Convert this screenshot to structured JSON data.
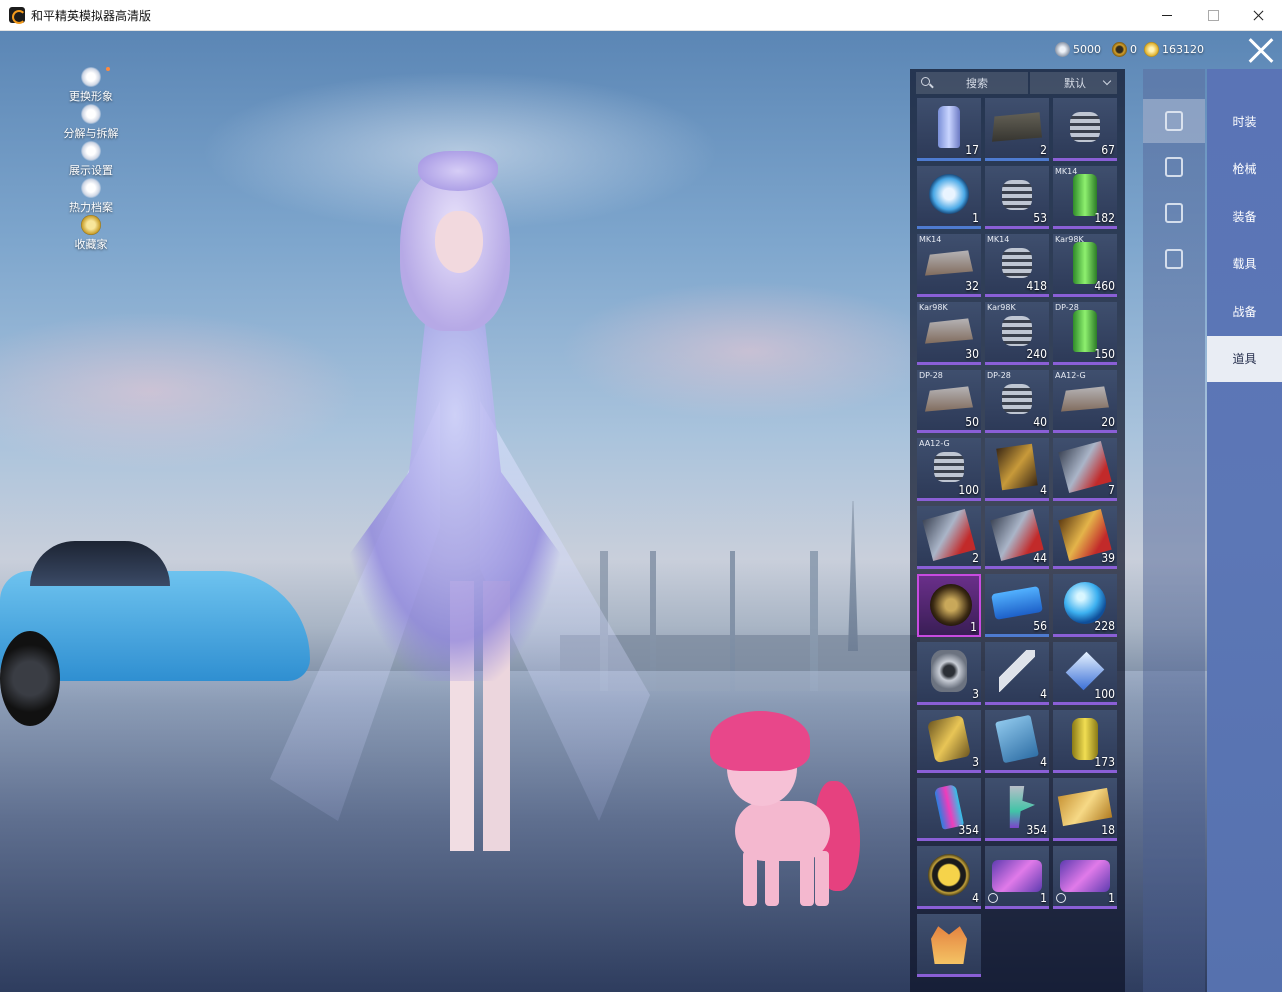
{
  "window": {
    "title": "和平精英模拟器高清版"
  },
  "left_menu": [
    {
      "label": "更换形象",
      "icon": "avatar-icon"
    },
    {
      "label": "分解与拆解",
      "icon": "puzzle-icon"
    },
    {
      "label": "展示设置",
      "icon": "eye-icon"
    },
    {
      "label": "热力档案",
      "icon": "flame-icon"
    },
    {
      "label": "收藏家",
      "icon": "collector-badge-icon"
    }
  ],
  "currency": {
    "silver": "5000",
    "gold_ring": "0",
    "coin": "163120"
  },
  "inventory": {
    "search_label": "搜索",
    "sort_label": "默认",
    "items": [
      {
        "tag": "",
        "count": "17",
        "art": "can",
        "rarity": "r-blue"
      },
      {
        "tag": "",
        "count": "2",
        "art": "kit",
        "rarity": "r-blue"
      },
      {
        "tag": "",
        "count": "67",
        "art": "spring",
        "rarity": "r-purple"
      },
      {
        "tag": "",
        "count": "1",
        "art": "disc",
        "rarity": "r-blue"
      },
      {
        "tag": "",
        "count": "53",
        "art": "spring",
        "rarity": "r-purple"
      },
      {
        "tag": "MK14",
        "count": "182",
        "art": "green",
        "rarity": "r-purple"
      },
      {
        "tag": "MK14",
        "count": "32",
        "art": "mag",
        "rarity": "r-purple"
      },
      {
        "tag": "MK14",
        "count": "418",
        "art": "spring",
        "rarity": "r-purple"
      },
      {
        "tag": "Kar98K",
        "count": "460",
        "art": "green",
        "rarity": "r-purple"
      },
      {
        "tag": "Kar98K",
        "count": "30",
        "art": "mag",
        "rarity": "r-purple"
      },
      {
        "tag": "Kar98K",
        "count": "240",
        "art": "spring",
        "rarity": "r-purple"
      },
      {
        "tag": "DP-28",
        "count": "150",
        "art": "green",
        "rarity": "r-purple"
      },
      {
        "tag": "DP-28",
        "count": "50",
        "art": "mag",
        "rarity": "r-purple"
      },
      {
        "tag": "DP-28",
        "count": "40",
        "art": "spring",
        "rarity": "r-purple"
      },
      {
        "tag": "AA12-G",
        "count": "20",
        "art": "mag",
        "rarity": "r-purple"
      },
      {
        "tag": "AA12-G",
        "count": "100",
        "art": "spring",
        "rarity": "r-purple"
      },
      {
        "tag": "",
        "count": "4",
        "art": "card",
        "rarity": "r-purple"
      },
      {
        "tag": "",
        "count": "7",
        "art": "ticket-red",
        "rarity": "r-purple"
      },
      {
        "tag": "",
        "count": "2",
        "art": "ticket-red",
        "rarity": "r-purple"
      },
      {
        "tag": "",
        "count": "44",
        "art": "ticket-red",
        "rarity": "r-purple"
      },
      {
        "tag": "",
        "count": "39",
        "art": "ticket-gold",
        "rarity": "r-purple"
      },
      {
        "tag": "",
        "count": "1",
        "art": "lion",
        "rarity": "r-magenta"
      },
      {
        "tag": "",
        "count": "56",
        "art": "blue-ticket",
        "rarity": "r-blue"
      },
      {
        "tag": "",
        "count": "228",
        "art": "orb",
        "rarity": "r-purple"
      },
      {
        "tag": "",
        "count": "3",
        "art": "nut",
        "rarity": "r-purple"
      },
      {
        "tag": "",
        "count": "4",
        "art": "key",
        "rarity": "r-purple"
      },
      {
        "tag": "",
        "count": "100",
        "art": "gem",
        "rarity": "r-purple"
      },
      {
        "tag": "",
        "count": "3",
        "art": "exclaim",
        "rarity": "r-purple"
      },
      {
        "tag": "",
        "count": "4",
        "art": "blue-card",
        "rarity": "r-purple"
      },
      {
        "tag": "",
        "count": "173",
        "art": "grenade",
        "rarity": "r-purple"
      },
      {
        "tag": "",
        "count": "354",
        "art": "spray",
        "rarity": "r-purple"
      },
      {
        "tag": "",
        "count": "354",
        "art": "gun",
        "rarity": "r-purple"
      },
      {
        "tag": "",
        "count": "18",
        "art": "gold-tag",
        "rarity": "r-purple"
      },
      {
        "tag": "",
        "count": "4",
        "art": "star-badge",
        "rarity": "r-purple"
      },
      {
        "tag": "",
        "count": "1",
        "art": "pink-card",
        "rarity": "r-purple",
        "clock": true
      },
      {
        "tag": "",
        "count": "1",
        "art": "pink-card",
        "rarity": "r-purple",
        "clock": true
      },
      {
        "tag": "",
        "count": "",
        "art": "crown",
        "rarity": "r-purple"
      }
    ]
  },
  "categories": [
    {
      "icon": "card-icon",
      "active": true
    },
    {
      "icon": "calendar-icon",
      "active": false
    },
    {
      "icon": "firework-icon",
      "active": false
    },
    {
      "icon": "ticket-icon",
      "active": false
    }
  ],
  "tabs": [
    {
      "label": "时装",
      "active": false
    },
    {
      "label": "枪械",
      "active": false
    },
    {
      "label": "装备",
      "active": false
    },
    {
      "label": "载具",
      "active": false
    },
    {
      "label": "战备",
      "active": false
    },
    {
      "label": "道具",
      "active": true
    }
  ]
}
